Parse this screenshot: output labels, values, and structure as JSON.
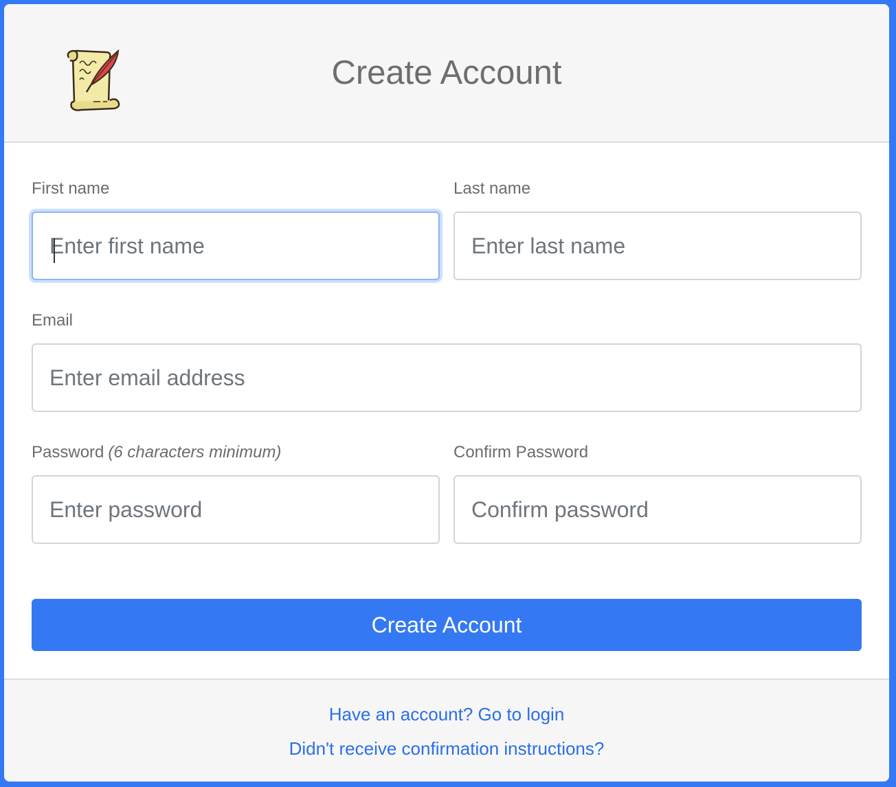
{
  "header": {
    "title": "Create Account"
  },
  "form": {
    "first_name": {
      "label": "First name",
      "placeholder": "Enter first name",
      "value": ""
    },
    "last_name": {
      "label": "Last name",
      "placeholder": "Enter last name",
      "value": ""
    },
    "email": {
      "label": "Email",
      "placeholder": "Enter email address",
      "value": ""
    },
    "password": {
      "label": "Password",
      "hint": "(6 characters minimum)",
      "placeholder": "Enter password",
      "value": ""
    },
    "confirm_password": {
      "label": "Confirm Password",
      "placeholder": "Confirm password",
      "value": ""
    },
    "submit_label": "Create Account"
  },
  "footer": {
    "login_link": "Have an account? Go to login",
    "confirmation_link": "Didn't receive confirmation instructions?"
  },
  "icons": {
    "logo": "scroll-quill-icon"
  },
  "colors": {
    "accent": "#3479f3",
    "link": "#2a6fe8",
    "focus_ring": "#cde0fc"
  }
}
